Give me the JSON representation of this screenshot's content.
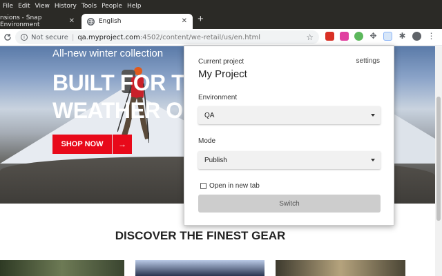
{
  "menu": {
    "items": [
      "File",
      "Edit",
      "View",
      "History",
      "Tools",
      "People",
      "Help"
    ]
  },
  "tabs": {
    "inactive_title": "nsions - Snap Environment",
    "active_title": "English"
  },
  "toolbar": {
    "security_label": "Not secure",
    "url_host": "qa.myproject.com",
    "url_path": ":4502/content/we-retail/us/en.html"
  },
  "hero": {
    "subtitle": "All-new winter collection",
    "headline": "BUILT FOR THE TOUGHEST WEATHER ON EARTH",
    "cta_label": "SHOP NOW",
    "cta_arrow": "→"
  },
  "section": {
    "title": "DISCOVER THE FINEST GEAR"
  },
  "popup": {
    "current_project_label": "Current project",
    "project_name": "My Project",
    "settings_label": "settings",
    "environment_label": "Environment",
    "environment_value": "QA",
    "mode_label": "Mode",
    "mode_value": "Publish",
    "new_tab_label": "Open in new tab",
    "new_tab_checked": false,
    "switch_label": "Switch"
  },
  "colors": {
    "cta_red": "#e8091a",
    "chrome_dark": "#2b2a26"
  }
}
